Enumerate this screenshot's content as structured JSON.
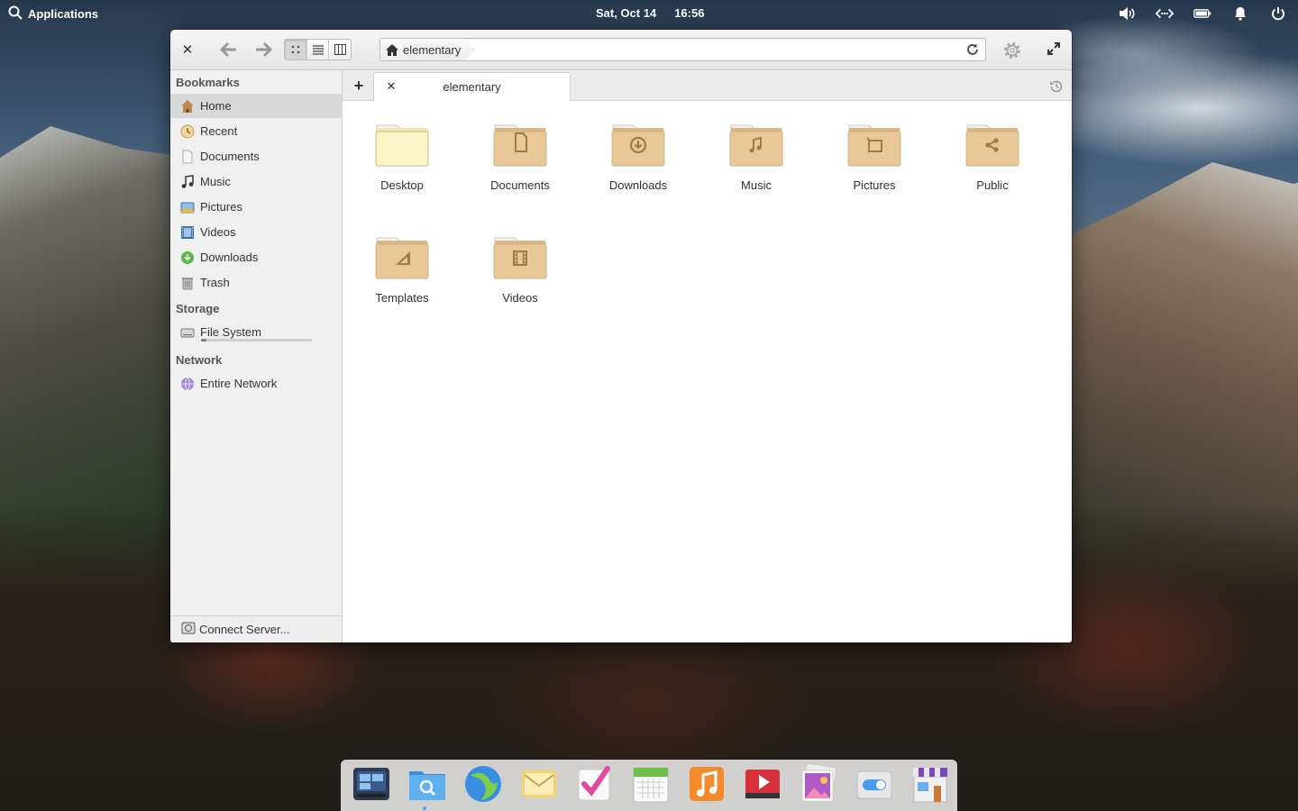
{
  "panel": {
    "applications_label": "Applications",
    "date": "Sat, Oct 14",
    "time": "16:56",
    "indicators": [
      "volume-icon",
      "network-icon",
      "battery-icon",
      "notifications-icon",
      "power-icon"
    ]
  },
  "window": {
    "path": {
      "crumb": "elementary"
    },
    "view_modes": [
      "icon-view",
      "list-view",
      "column-view"
    ],
    "active_view": "icon-view"
  },
  "sidebar": {
    "bookmarks_heading": "Bookmarks",
    "bookmarks": [
      {
        "label": "Home",
        "icon": "home-icon",
        "selected": true
      },
      {
        "label": "Recent",
        "icon": "recent-icon"
      },
      {
        "label": "Documents",
        "icon": "documents-icon"
      },
      {
        "label": "Music",
        "icon": "music-icon"
      },
      {
        "label": "Pictures",
        "icon": "pictures-icon"
      },
      {
        "label": "Videos",
        "icon": "videos-icon"
      },
      {
        "label": "Downloads",
        "icon": "downloads-icon"
      },
      {
        "label": "Trash",
        "icon": "trash-icon"
      }
    ],
    "storage_heading": "Storage",
    "storage": [
      {
        "label": "File System",
        "icon": "harddisk-icon",
        "usage_fraction": 0.05
      }
    ],
    "network_heading": "Network",
    "network": [
      {
        "label": "Entire Network",
        "icon": "network-globe-icon"
      }
    ],
    "footer_label": "Connect Server..."
  },
  "tabs": [
    {
      "label": "elementary"
    }
  ],
  "folders": [
    {
      "label": "Desktop",
      "emblem": "none"
    },
    {
      "label": "Documents",
      "emblem": "document"
    },
    {
      "label": "Downloads",
      "emblem": "download"
    },
    {
      "label": "Music",
      "emblem": "music"
    },
    {
      "label": "Pictures",
      "emblem": "picture"
    },
    {
      "label": "Public",
      "emblem": "share"
    },
    {
      "label": "Templates",
      "emblem": "template"
    },
    {
      "label": "Videos",
      "emblem": "video"
    }
  ],
  "dock": {
    "apps": [
      "multitasking-view-icon",
      "files-icon",
      "web-browser-icon",
      "mail-icon",
      "tasks-icon",
      "calendar-icon",
      "music-app-icon",
      "videos-app-icon",
      "photos-icon",
      "system-settings-icon",
      "appcenter-icon"
    ],
    "running": [
      "files-icon"
    ]
  },
  "colors": {
    "folder_fill": "#e8c898",
    "folder_desktop": "#fbf4c6",
    "accent": "#4aa0f0"
  }
}
